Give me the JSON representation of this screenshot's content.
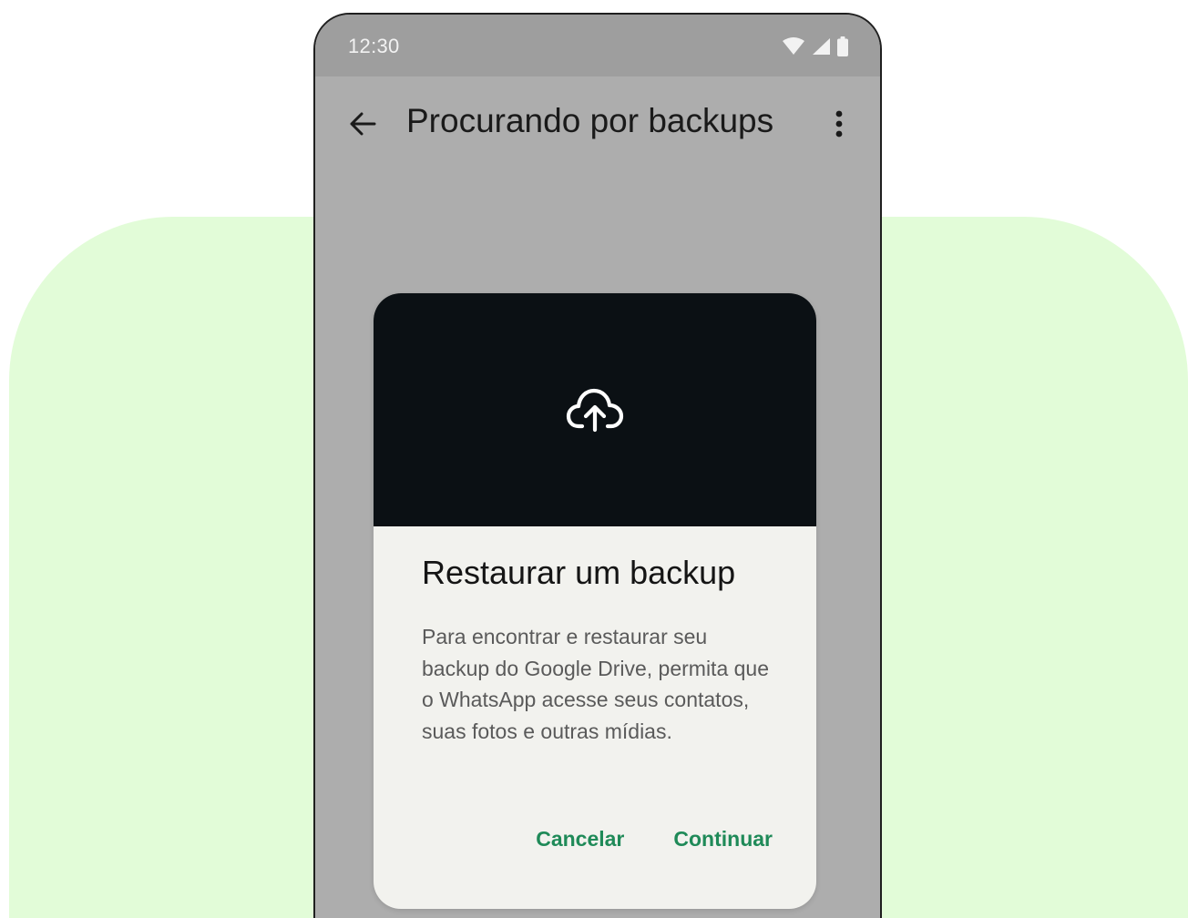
{
  "status_bar": {
    "time": "12:30",
    "icons": [
      "wifi-icon",
      "cell-signal-icon",
      "battery-icon"
    ]
  },
  "app_bar": {
    "back_icon": "arrow-left-icon",
    "title": "Procurando por backups",
    "menu_icon": "more-vert-icon"
  },
  "dialog": {
    "hero_icon": "cloud-upload-icon",
    "title": "Restaurar um backup",
    "body": "Para encontrar e restaurar seu backup do Google Drive, permita que o WhatsApp acesse seus contatos, suas fotos e outras mídias.",
    "cancel_label": "Cancelar",
    "continue_label": "Continuar"
  },
  "colors": {
    "background_blob": "#e2fcd8",
    "screen_dim": "#adadad",
    "dialog_hero": "#0b1014",
    "dialog_surface": "#f2f2ee",
    "accent_green": "#1f8a58"
  }
}
